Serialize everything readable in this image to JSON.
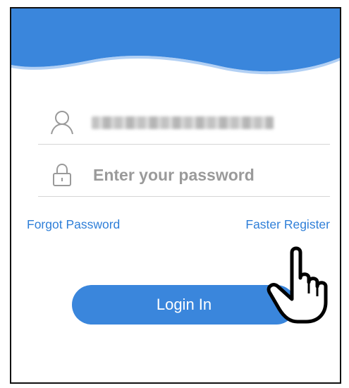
{
  "header": {
    "background_color": "#3a86dc",
    "wave_color": "#ffffff"
  },
  "username_field": {
    "icon": "user-icon",
    "value": "████████████████"
  },
  "password_field": {
    "icon": "lock-icon",
    "placeholder": "Enter your password"
  },
  "links": {
    "forgot_password": "Forgot Password",
    "faster_register": "Faster Register"
  },
  "login_button": {
    "label": "Login In",
    "color": "#3a86dc"
  },
  "overlay": {
    "icon": "hand-pointer-icon"
  },
  "colors": {
    "link": "#2f7fd8",
    "divider": "#d6d6d6",
    "placeholder": "#9a9a9a"
  }
}
